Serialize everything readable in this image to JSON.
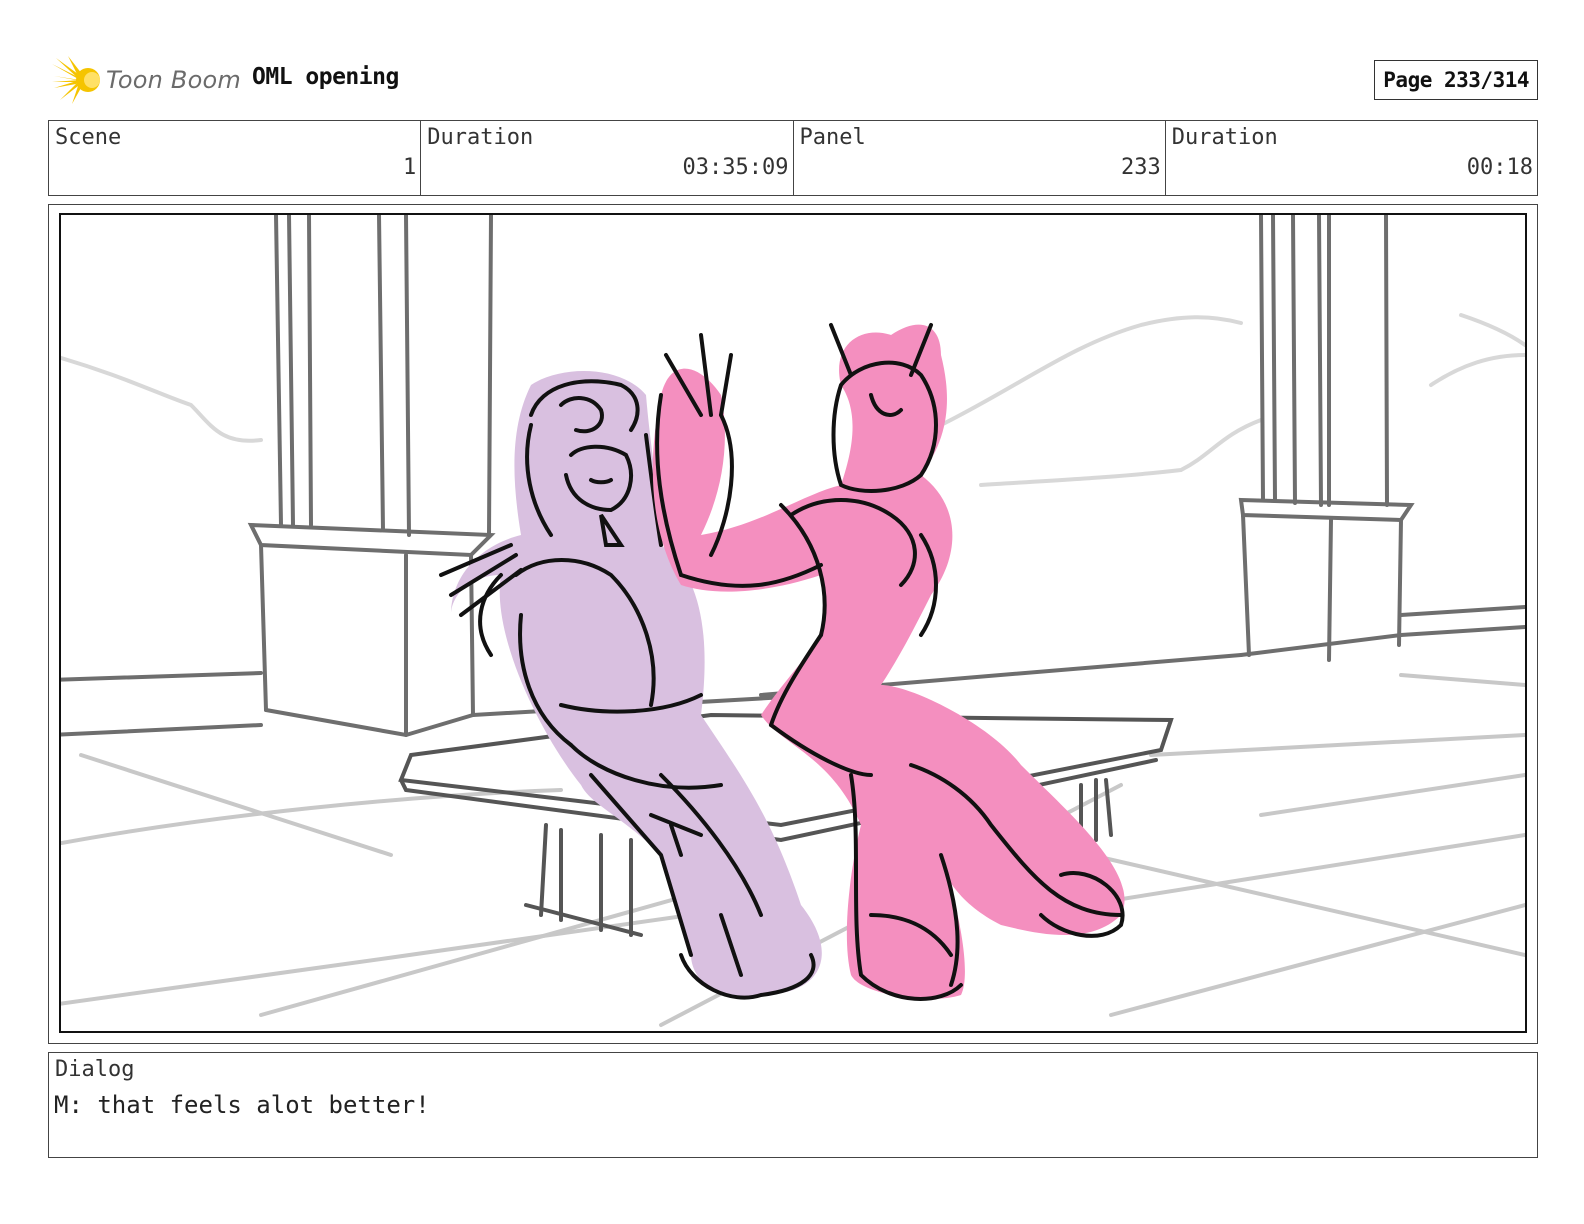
{
  "header": {
    "logo_text": "Toon Boom",
    "project_title": "OML opening",
    "page_label": "Page 233/314"
  },
  "info": {
    "scene_label": "Scene",
    "scene_value": "1",
    "scene_duration_label": "Duration",
    "scene_duration_value": "03:35:09",
    "panel_label": "Panel",
    "panel_value": "233",
    "panel_duration_label": "Duration",
    "panel_duration_value": "00:18"
  },
  "dialog": {
    "label": "Dialog",
    "text": "M: that feels alot better!"
  },
  "colors": {
    "logo_yellow": "#f5c400",
    "character_lavender": "#d9c0e0",
    "character_pink": "#f48fbf",
    "line_black": "#111111",
    "background_gray": "#777777"
  }
}
